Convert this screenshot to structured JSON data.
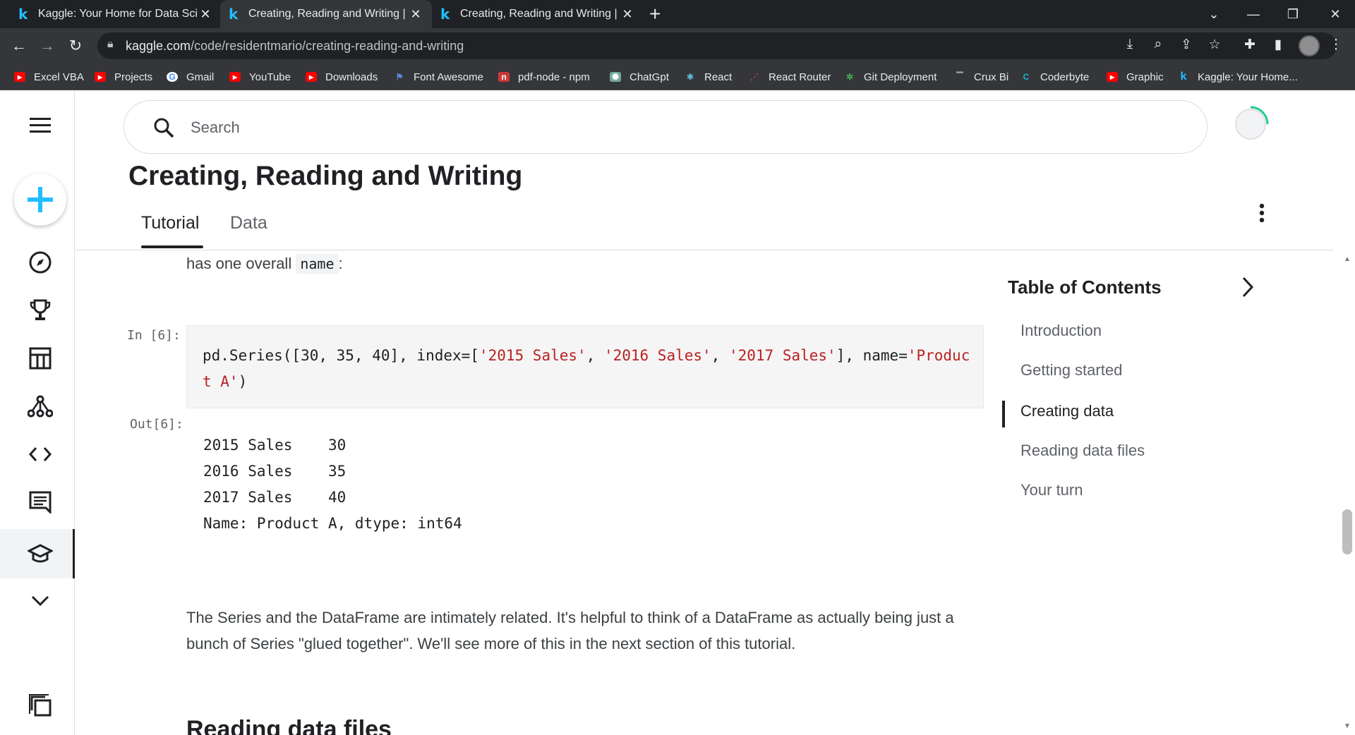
{
  "browser": {
    "tabs": [
      {
        "title": "Kaggle: Your Home for Data Scie",
        "active": false
      },
      {
        "title": "Creating, Reading and Writing | K",
        "active": true
      },
      {
        "title": "Creating, Reading and Writing | K",
        "active": false
      }
    ],
    "url": {
      "host": "kaggle.com",
      "path": "/code/residentmario/creating-reading-and-writing"
    },
    "bookmarks": [
      {
        "label": "Excel VBA",
        "icon": "youtube-icon",
        "color": "#ff0000"
      },
      {
        "label": "Projects",
        "icon": "youtube-icon",
        "color": "#ff0000"
      },
      {
        "label": "Gmail",
        "icon": "google-icon",
        "color": "#4285f4"
      },
      {
        "label": "YouTube",
        "icon": "youtube-icon",
        "color": "#ff0000"
      },
      {
        "label": "Downloads",
        "icon": "youtube-icon",
        "color": "#ff0000"
      },
      {
        "label": "Font Awesome",
        "icon": "flag-icon",
        "color": "#528dd7"
      },
      {
        "label": "pdf-node - npm",
        "icon": "npm-icon",
        "color": "#cb3837"
      },
      {
        "label": "ChatGpt",
        "icon": "openai-icon",
        "color": "#74aa9c"
      },
      {
        "label": "React",
        "icon": "react-icon",
        "color": "#61dafb"
      },
      {
        "label": "React Router",
        "icon": "react-router-icon",
        "color": "#ca4245"
      },
      {
        "label": "Git Deployment",
        "icon": "git-deploy-icon",
        "color": "#3fb950"
      },
      {
        "label": "Crux Bi",
        "icon": "crux-icon",
        "color": "#9aa0a6"
      },
      {
        "label": "Coderbyte",
        "icon": "coderbyte-icon",
        "color": "#15b5d4"
      },
      {
        "label": "Graphic",
        "icon": "youtube-icon",
        "color": "#ff0000"
      },
      {
        "label": "Kaggle: Your Home...",
        "icon": "kaggle-icon",
        "color": "#20beff"
      }
    ]
  },
  "search": {
    "placeholder": "Search"
  },
  "page": {
    "title": "Creating, Reading and Writing",
    "tabs": [
      "Tutorial",
      "Data"
    ],
    "active_tab": "Tutorial"
  },
  "notebook": {
    "intro_text": "has one overall",
    "intro_code": "name",
    "intro_suffix": ":",
    "in_prompt": "In [6]:",
    "code_parts": [
      {
        "text": "pd.Series([30, 35, 40], index=[",
        "type": "plain"
      },
      {
        "text": "'2015 Sales'",
        "type": "str"
      },
      {
        "text": ", ",
        "type": "plain"
      },
      {
        "text": "'2016 Sales'",
        "type": "str"
      },
      {
        "text": ", ",
        "type": "plain"
      },
      {
        "text": "'2017 Sales'",
        "type": "str"
      },
      {
        "text": "], name=",
        "type": "plain"
      },
      {
        "text": "'Product A'",
        "type": "str"
      },
      {
        "text": ")",
        "type": "plain"
      }
    ],
    "out_prompt": "Out[6]:",
    "output_lines": [
      "2015 Sales    30",
      "2016 Sales    35",
      "2017 Sales    40",
      "Name: Product A, dtype: int64"
    ],
    "paragraph": "The Series and the DataFrame are intimately related. It's helpful to think of a DataFrame as actually being just a bunch of Series \"glued together\". We'll see more of this in the next section of this tutorial.",
    "next_heading": "Reading data files"
  },
  "toc": {
    "title": "Table of Contents",
    "items": [
      "Introduction",
      "Getting started",
      "Creating data",
      "Reading data files",
      "Your turn"
    ],
    "active": "Creating data"
  }
}
